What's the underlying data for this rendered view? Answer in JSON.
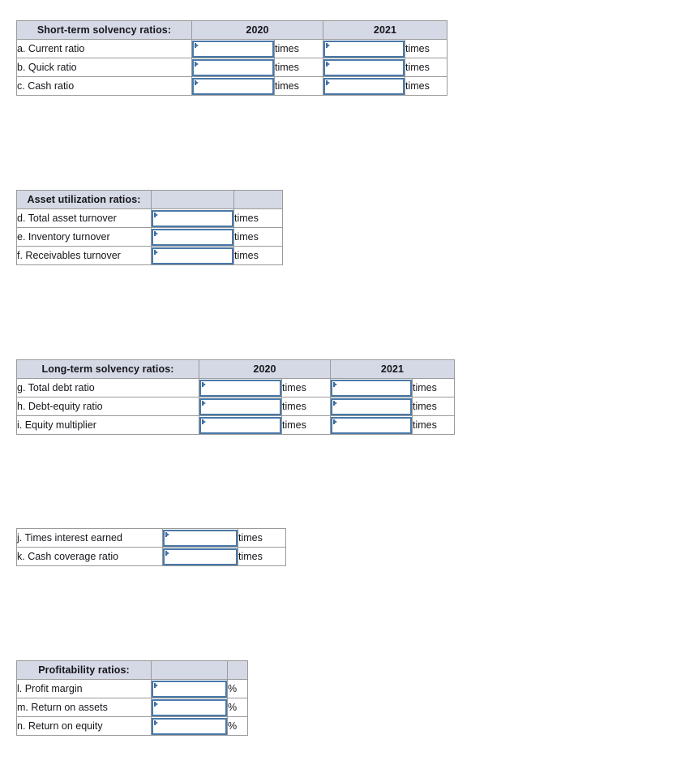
{
  "colors": {
    "header_bg": "#d5d9e5",
    "grid_border": "#9a9a9a",
    "input_border": "#4a79a8",
    "text": "#16161c",
    "page_bg": "#ffffff"
  },
  "units": {
    "times": "times",
    "percent": "%"
  },
  "tables": [
    {
      "id": "short-term-solvency",
      "title": "Short-term solvency ratios:",
      "columns": [
        "2020",
        "2021"
      ],
      "unit": "times",
      "rows": [
        {
          "label": "a. Current ratio",
          "values": [
            "",
            ""
          ]
        },
        {
          "label": "b. Quick ratio",
          "values": [
            "",
            ""
          ]
        },
        {
          "label": "c. Cash ratio",
          "values": [
            "",
            ""
          ]
        }
      ]
    },
    {
      "id": "asset-utilization",
      "title": "Asset utilization ratios:",
      "columns": [
        "",
        ""
      ],
      "unit": "times",
      "rows": [
        {
          "label": "d. Total asset turnover",
          "values": [
            ""
          ]
        },
        {
          "label": "e. Inventory turnover",
          "values": [
            ""
          ]
        },
        {
          "label": "f. Receivables turnover",
          "values": [
            ""
          ]
        }
      ]
    },
    {
      "id": "long-term-solvency",
      "title": "Long-term solvency ratios:",
      "columns": [
        "2020",
        "2021"
      ],
      "unit": "times",
      "rows": [
        {
          "label": "g. Total debt ratio",
          "values": [
            "",
            ""
          ]
        },
        {
          "label": "h. Debt-equity ratio",
          "values": [
            "",
            ""
          ]
        },
        {
          "label": "i. Equity multiplier",
          "values": [
            "",
            ""
          ]
        }
      ]
    },
    {
      "id": "coverage-ratios",
      "title": "",
      "columns": [],
      "unit": "times",
      "rows": [
        {
          "label": "j. Times interest earned",
          "values": [
            ""
          ]
        },
        {
          "label": "k. Cash coverage ratio",
          "values": [
            ""
          ]
        }
      ]
    },
    {
      "id": "profitability",
      "title": "Profitability ratios:",
      "columns": [
        "",
        ""
      ],
      "unit": "%",
      "rows": [
        {
          "label": "l. Profit margin",
          "values": [
            ""
          ]
        },
        {
          "label": "m. Return on assets",
          "values": [
            ""
          ]
        },
        {
          "label": "n. Return on equity",
          "values": [
            ""
          ]
        }
      ]
    }
  ]
}
